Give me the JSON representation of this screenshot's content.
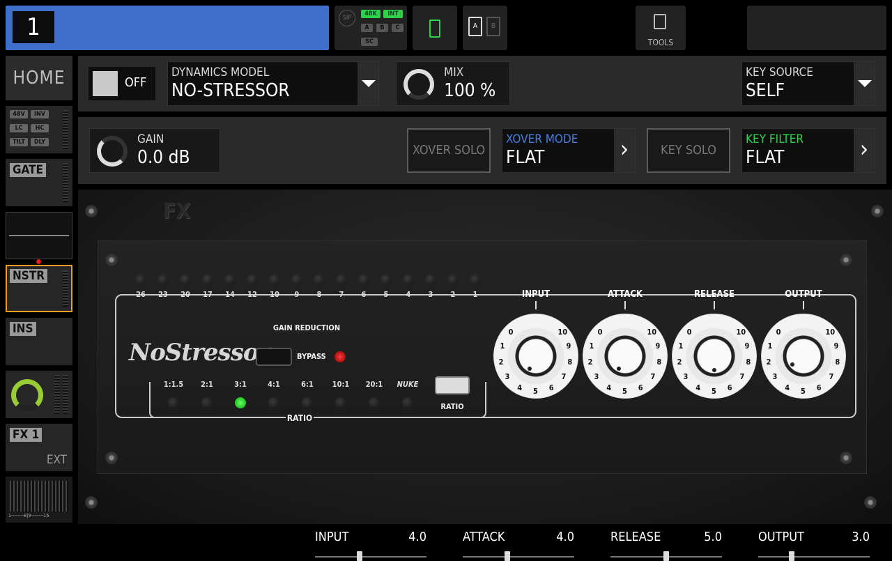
{
  "channel": {
    "number": "1",
    "color": "#3f6fcc"
  },
  "header": {
    "sip_label": "SIP",
    "rate_tags": [
      "48K",
      "INT"
    ],
    "bus_tags": [
      "A",
      "B",
      "C"
    ],
    "sc_tag": "SC",
    "card_tags": [
      "A",
      "B"
    ],
    "tools_label": "TOOLS"
  },
  "sidebar": {
    "home": "HOME",
    "input_tags": [
      "48V",
      "INV",
      "LC",
      "HC",
      "TILT",
      "DLY"
    ],
    "gate": "GATE",
    "dyn": "NSTR",
    "ins": "INS",
    "fx": "FX 1",
    "fx_sub": "EXT",
    "meter_scale": "1--------8|9--------16"
  },
  "row1": {
    "power_label": "OFF",
    "model_label": "DYNAMICS MODEL",
    "model_value": "NO-STRESSOR",
    "mix_label": "MIX",
    "mix_value": "100 %",
    "mix_percent": 100,
    "key_source_label": "KEY SOURCE",
    "key_source_value": "SELF"
  },
  "row2": {
    "gain_label": "GAIN",
    "gain_value": "0.0 dB",
    "xover_solo": "XOVER SOLO",
    "xover_mode_label": "XOVER MODE",
    "xover_mode_value": "FLAT",
    "key_solo": "KEY SOLO",
    "key_filter_label": "KEY FILTER",
    "key_filter_value": "FLAT"
  },
  "device": {
    "brand": "FX",
    "name": "NoStressor",
    "gain_reduction_label": "GAIN REDUCTION",
    "bypass_label": "BYPASS",
    "meter_leds": [
      "26",
      "23",
      "20",
      "17",
      "14",
      "12",
      "10",
      "9",
      "8",
      "7",
      "6",
      "5",
      "4",
      "3",
      "2",
      "1"
    ],
    "ratios": [
      "1:1.5",
      "2:1",
      "3:1",
      "4:1",
      "6:1",
      "10:1",
      "20:1",
      "NUKE"
    ],
    "active_ratio": "3:1",
    "ratio_label": "RATIO",
    "ratio_button_label": "RATIO",
    "knobs": [
      {
        "title": "INPUT",
        "value": 4.0
      },
      {
        "title": "ATTACK",
        "value": 4.0
      },
      {
        "title": "RELEASE",
        "value": 5.0
      },
      {
        "title": "OUTPUT",
        "value": 3.0
      }
    ],
    "knob_scale": [
      "0",
      "1",
      "2",
      "3",
      "4",
      "5",
      "6",
      "7",
      "8",
      "9",
      "10"
    ]
  },
  "params": [
    {
      "name": "INPUT",
      "value": "4.0",
      "level": 0.4
    },
    {
      "name": "ATTACK",
      "value": "4.0",
      "level": 0.4
    },
    {
      "name": "RELEASE",
      "value": "5.0",
      "level": 0.5
    },
    {
      "name": "OUTPUT",
      "value": "3.0",
      "level": 0.3
    }
  ],
  "colors": {
    "accent_blue": "#4a7ee0",
    "accent_green": "#2fd04a",
    "selected_orange": "#f0a020"
  }
}
